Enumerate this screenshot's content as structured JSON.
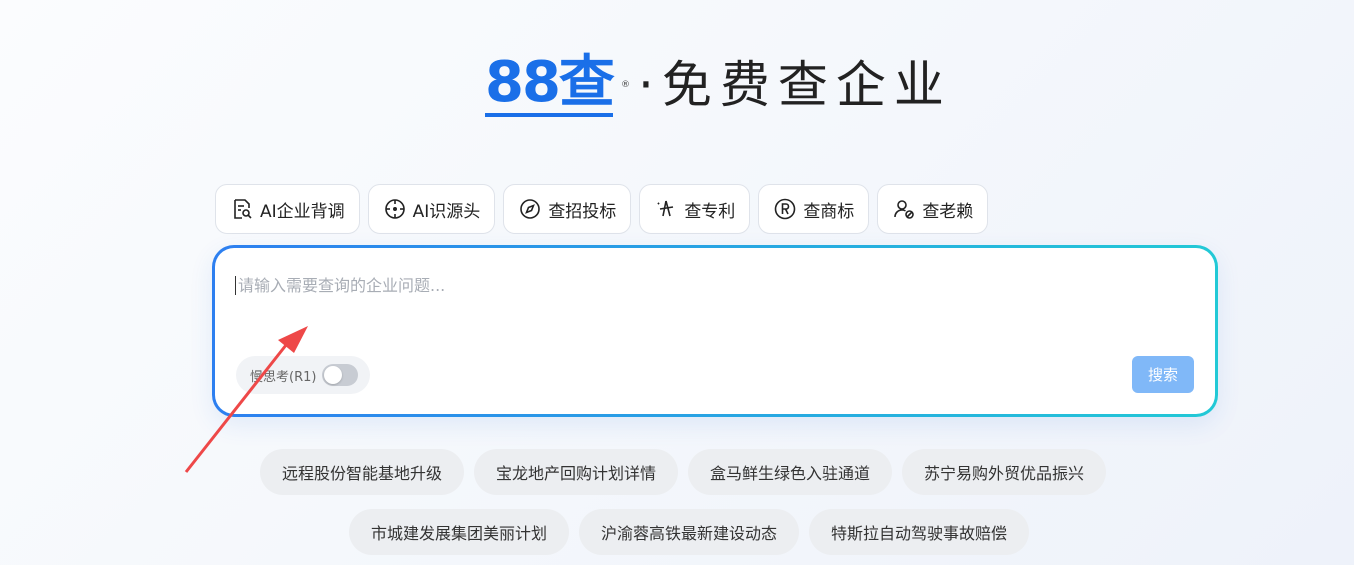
{
  "logo": {
    "brand": "88查",
    "reg_mark": "®",
    "slogan": "·免费查企业"
  },
  "tools": [
    {
      "label": "AI企业背调",
      "icon": "doc-search-icon"
    },
    {
      "label": "AI识源头",
      "icon": "crosshair-icon"
    },
    {
      "label": "查招投标",
      "icon": "compass-icon"
    },
    {
      "label": "查专利",
      "icon": "sparkle-icon"
    },
    {
      "label": "查商标",
      "icon": "registered-icon"
    },
    {
      "label": "查老赖",
      "icon": "user-ban-icon"
    }
  ],
  "search": {
    "placeholder": "请输入需要查询的企业问题...",
    "value": "",
    "think_label": "慢思考(R1)",
    "button_label": "搜索"
  },
  "suggestions_row1": [
    "远程股份智能基地升级",
    "宝龙地产回购计划详情",
    "盒马鲜生绿色入驻通道",
    "苏宁易购外贸优品振兴"
  ],
  "suggestions_row2": [
    "市城建发展集团美丽计划",
    "沪渝蓉高铁最新建设动态",
    "特斯拉自动驾驶事故赔偿"
  ],
  "colors": {
    "brand": "#1a6fe8",
    "annotation_arrow": "#ee4848",
    "search_button": "#80b8f8"
  }
}
